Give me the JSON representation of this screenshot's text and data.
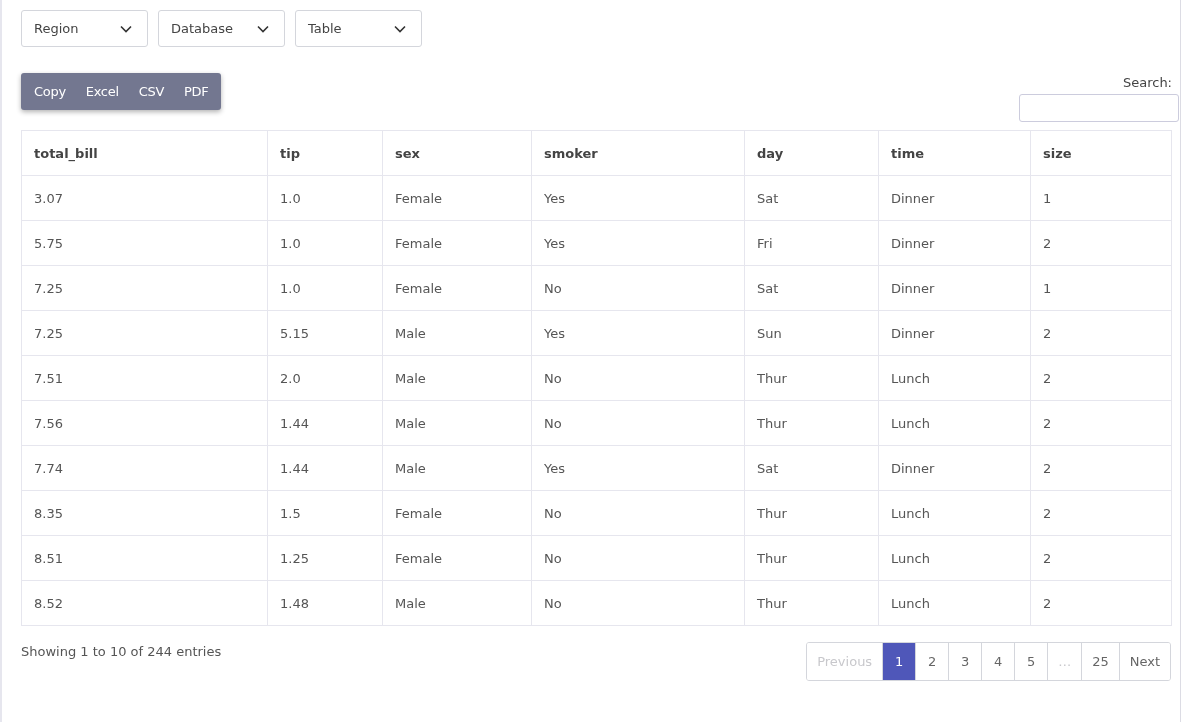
{
  "filters": [
    {
      "label": "Region"
    },
    {
      "label": "Database"
    },
    {
      "label": "Table"
    }
  ],
  "export_buttons": [
    "Copy",
    "Excel",
    "CSV",
    "PDF"
  ],
  "search": {
    "label": "Search:"
  },
  "table": {
    "columns": [
      "total_bill",
      "tip",
      "sex",
      "smoker",
      "day",
      "time",
      "size"
    ],
    "rows": [
      [
        "3.07",
        "1.0",
        "Female",
        "Yes",
        "Sat",
        "Dinner",
        "1"
      ],
      [
        "5.75",
        "1.0",
        "Female",
        "Yes",
        "Fri",
        "Dinner",
        "2"
      ],
      [
        "7.25",
        "1.0",
        "Female",
        "No",
        "Sat",
        "Dinner",
        "1"
      ],
      [
        "7.25",
        "5.15",
        "Male",
        "Yes",
        "Sun",
        "Dinner",
        "2"
      ],
      [
        "7.51",
        "2.0",
        "Male",
        "No",
        "Thur",
        "Lunch",
        "2"
      ],
      [
        "7.56",
        "1.44",
        "Male",
        "No",
        "Thur",
        "Lunch",
        "2"
      ],
      [
        "7.74",
        "1.44",
        "Male",
        "Yes",
        "Sat",
        "Dinner",
        "2"
      ],
      [
        "8.35",
        "1.5",
        "Female",
        "No",
        "Thur",
        "Lunch",
        "2"
      ],
      [
        "8.51",
        "1.25",
        "Female",
        "No",
        "Thur",
        "Lunch",
        "2"
      ],
      [
        "8.52",
        "1.48",
        "Male",
        "No",
        "Thur",
        "Lunch",
        "2"
      ]
    ]
  },
  "info": "Showing 1 to 10 of 244 entries",
  "pagination": [
    {
      "label": "Previous",
      "selected": false,
      "disabled": true
    },
    {
      "label": "1",
      "selected": true,
      "disabled": false
    },
    {
      "label": "2",
      "selected": false,
      "disabled": false
    },
    {
      "label": "3",
      "selected": false,
      "disabled": false
    },
    {
      "label": "4",
      "selected": false,
      "disabled": false
    },
    {
      "label": "5",
      "selected": false,
      "disabled": false
    },
    {
      "label": "…",
      "selected": false,
      "disabled": true
    },
    {
      "label": "25",
      "selected": false,
      "disabled": false
    },
    {
      "label": "Next",
      "selected": false,
      "disabled": false
    }
  ]
}
